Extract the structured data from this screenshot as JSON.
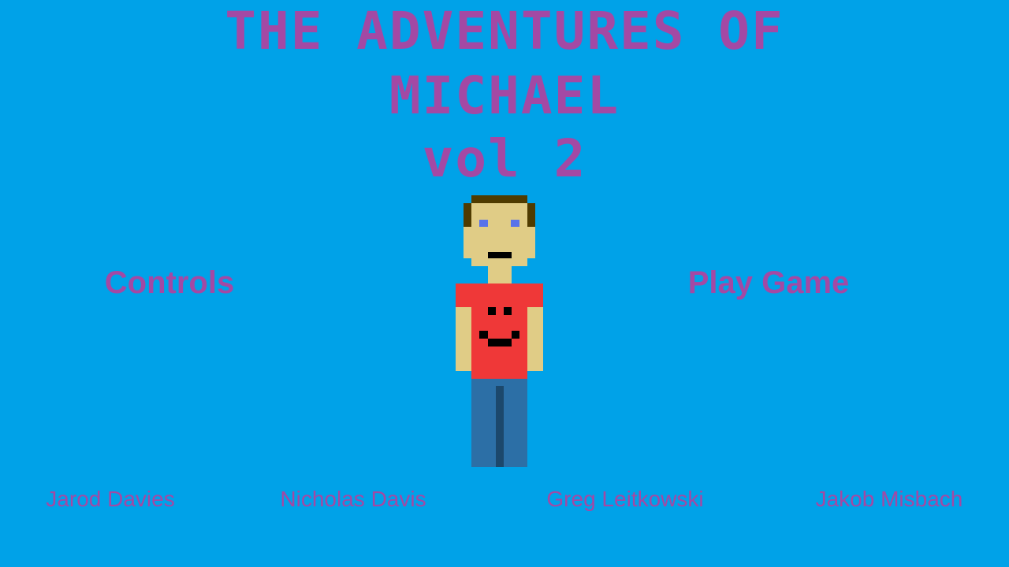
{
  "title": {
    "line1": "THE ADVENTURES OF",
    "line2": "MICHAEL",
    "line3": "vol 2"
  },
  "menu": {
    "controls_label": "Controls",
    "play_label": "Play Game"
  },
  "credits": [
    "Jarod Davies",
    "Nicholas Davis",
    "Greg Leitkowski",
    "Jakob Misbach"
  ],
  "character": {
    "icon": "pixel-michael-character-icon",
    "hair_color": "#4f3b00",
    "skin_color": "#e0cc86",
    "eye_color": "#5872ea",
    "shirt_color": "#ef3838",
    "pants_color": "#2c6fa6",
    "face_color": "#000000"
  },
  "colors": {
    "background": "#00a2e8",
    "text": "#a349a4"
  }
}
